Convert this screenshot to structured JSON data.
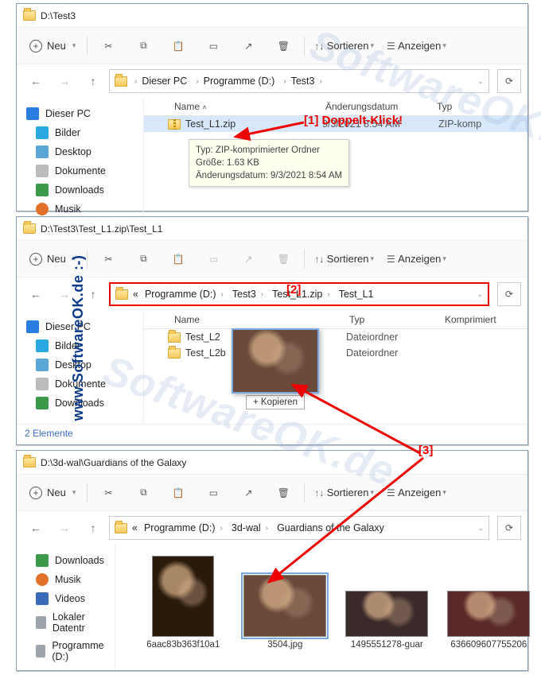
{
  "watermark": "www.SoftwareOK.de :-)",
  "watermark_big": "SoftwareOK.de",
  "annotations": {
    "a1": "[1]  Doppelt-Klick!",
    "a2": "[2]",
    "a3": "[3]"
  },
  "toolbar": {
    "neu": "Neu",
    "sortieren": "Sortieren",
    "anzeigen": "Anzeigen"
  },
  "win1": {
    "title": "D:\\Test3",
    "breadcrumb": [
      "Dieser PC",
      "Programme (D:)",
      "Test3"
    ],
    "cols": {
      "name": "Name",
      "date": "Änderungsdatum",
      "type": "Typ"
    },
    "file": {
      "name": "Test_L1.zip",
      "date": "9/3/2021 8:54 AM",
      "type": "ZIP-komp"
    },
    "tooltip": {
      "l1": "Typ: ZIP-komprimierter Ordner",
      "l2": "Größe: 1.63 KB",
      "l3": "Änderungsdatum: 9/3/2021 8:54 AM"
    },
    "side": [
      "Dieser PC",
      "Bilder",
      "Desktop",
      "Dokumente",
      "Downloads",
      "Musik"
    ]
  },
  "win2": {
    "title": "D:\\Test3\\Test_L1.zip\\Test_L1",
    "breadcrumb_prefix": "«",
    "breadcrumb": [
      "Programme (D:)",
      "Test3",
      "Test_L1.zip",
      "Test_L1"
    ],
    "cols": {
      "name": "Name",
      "type": "Typ",
      "komp": "Komprimiert"
    },
    "rows": [
      {
        "name": "Test_L2",
        "type": "Dateiordner"
      },
      {
        "name": "Test_L2b",
        "type": "Dateiordner"
      }
    ],
    "side": [
      "Dieser PC",
      "Bilder",
      "Desktop",
      "Dokumente",
      "Downloads"
    ],
    "status": "2 Elemente",
    "drag_label": "+ Kopieren"
  },
  "win3": {
    "title": "D:\\3d-wal\\Guardians of the Galaxy",
    "breadcrumb_prefix": "«",
    "breadcrumb": [
      "Programme (D:)",
      "3d-wal",
      "Guardians of the Galaxy"
    ],
    "side": [
      "Downloads",
      "Musik",
      "Videos",
      "Lokaler Datentr",
      "Programme (D:)"
    ],
    "items": [
      "6aac83b363f10a1",
      "3504.jpg",
      "1495551278-guar",
      "636609607755206"
    ]
  }
}
